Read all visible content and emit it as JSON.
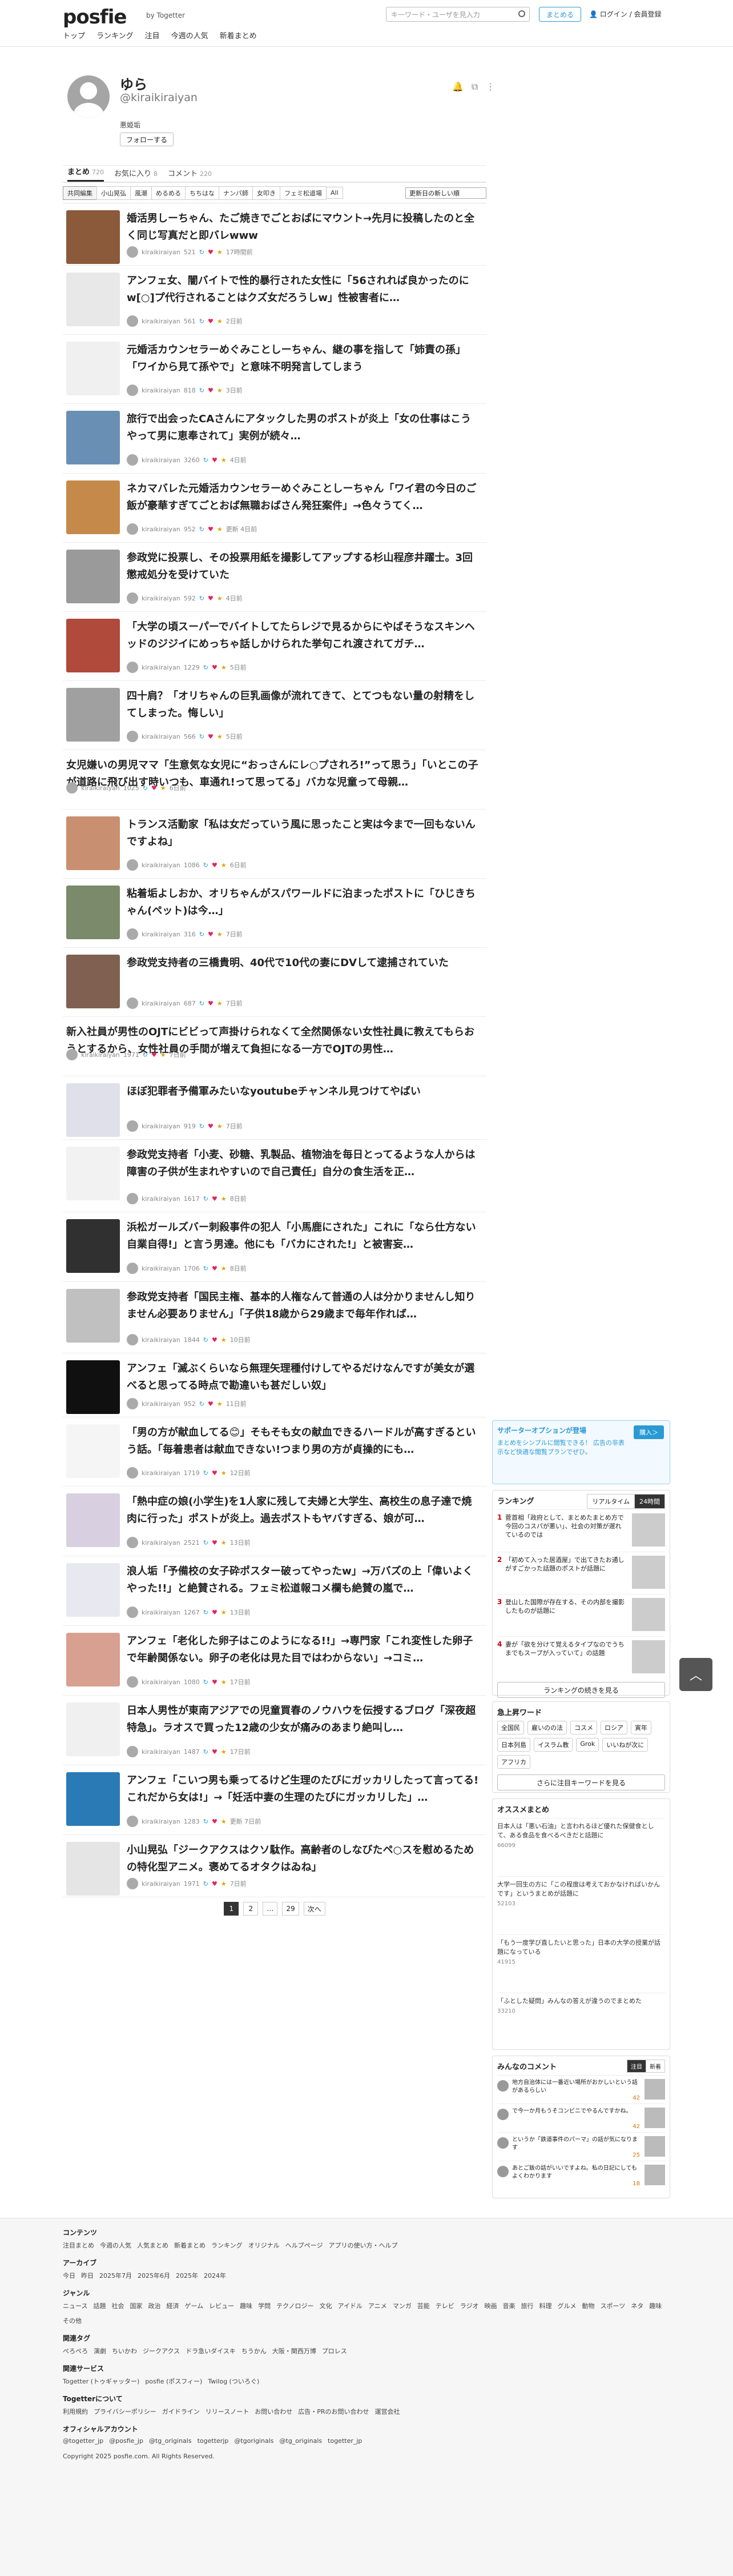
{
  "header": {
    "logo": "posfie",
    "togetter": "Togetter",
    "nav": [
      "トップ",
      "ランキング",
      "注目",
      "今週の人気",
      "新着まとめ"
    ],
    "search_placeholder": "キーワード・ユーザを見入力",
    "summarize_button": "まとめる",
    "login": "ログイン / 会員登録"
  },
  "profile": {
    "name": "ゆら",
    "handle": "@kiraikiraiyan",
    "bio": "悪姫垢",
    "follow": "フォローする"
  },
  "tabs": [
    {
      "label": "まとめ",
      "count": "720"
    },
    {
      "label": "お気に入り",
      "count": "8"
    },
    {
      "label": "コメント",
      "count": "220"
    }
  ],
  "filters": [
    "共同編集",
    "小山晃弘",
    "風潮",
    "めるめる",
    "ちちはな",
    "ナンパ師",
    "女叩き",
    "フェミ松道場",
    "All"
  ],
  "sort_select": "更新日の新しい順",
  "items": [
    {
      "title": "婚活男しーちゃん、たご焼きでごとおばにマウント→先月に投稿したのと全く同じ写真だと即バレwww",
      "user": "kiraikiraiyan",
      "stats": "521",
      "time": "17時間前",
      "thumb": "#8a5a3a",
      "nothumb": false
    },
    {
      "title": "アンフェ女、闇バイトで性的暴行された女性に「56されれば良かったのにw[○]プ代行されることはクズ女だろうしw」性被害者に…",
      "user": "kiraikiraiyan",
      "stats": "561",
      "time": "2日前",
      "thumb": "#e8e8e8",
      "nothumb": false
    },
    {
      "title": "元婚活カウンセラーめぐみことしーちゃん、継の事を指して「姉責の孫」「ワイから見て孫やで」と意味不明発言してしまう",
      "user": "kiraikiraiyan",
      "stats": "818",
      "time": "3日前",
      "thumb": "#f0f0f0",
      "nothumb": false
    },
    {
      "title": "旅行で出会ったCAさんにアタックした男のポストが炎上「女の仕事はこうやって男に恵奉されて」実例が続々…",
      "user": "kiraikiraiyan",
      "stats": "3260",
      "time": "4日前",
      "thumb": "#6a8fb5",
      "nothumb": false
    },
    {
      "title": "ネカマバレた元婚活カウンセラーめぐみことしーちゃん「ワイ君の今日のご飯が豪華すぎてごとおば無職おばさん発狂案件」→色々うてく…",
      "user": "kiraikiraiyan",
      "stats": "952",
      "time": "更新 4日前",
      "thumb": "#c58a4a",
      "nothumb": false
    },
    {
      "title": "参政党に投票し、その投票用紙を撮影してアップする杉山程彦井躍士。3回懲戒処分を受けていた",
      "user": "kiraikiraiyan",
      "stats": "592",
      "time": "4日前",
      "thumb": "#9a9a9a",
      "nothumb": false
    },
    {
      "title": "「大学の頃スーパーでバイトしてたらレジで見るからにやばそうなスキンヘッドのジジイにめっちゃ話しかけられた挙句これ渡されてガチ…",
      "user": "kiraikiraiyan",
      "stats": "1229",
      "time": "5日前",
      "thumb": "#b04a3a",
      "nothumb": false
    },
    {
      "title": "四十肩？「オリちゃんの巨乳画像が流れてきて、とてつもない量の射精をしてしまった。悔しい」",
      "user": "kiraikiraiyan",
      "stats": "566",
      "time": "5日前",
      "thumb": "#a0a0a0",
      "nothumb": false
    },
    {
      "title": "女児嫌いの男児ママ「生意気な女児に“おっさんにレ○プされろ!”って思う」「いとこの子が道路に飛び出す時いつも、車通れ!って思ってる」バカな児童って母親…",
      "user": "kiraikiraiyan",
      "stats": "1025",
      "time": "6日前",
      "thumb": "",
      "nothumb": true
    },
    {
      "title": "トランス活動家「私は女だっていう風に思ったこと実は今まで一回もないんですよね」",
      "user": "kiraikiraiyan",
      "stats": "1086",
      "time": "6日前",
      "thumb": "#c89070",
      "nothumb": false
    },
    {
      "title": "粘着垢よしおか、オリちゃんがスパワールドに泊まったポストに「ひじきちゃん(ペット)は今…」",
      "user": "kiraikiraiyan",
      "stats": "316",
      "time": "7日前",
      "thumb": "#7a8a6a",
      "nothumb": false
    },
    {
      "title": "参政党支持者の三橋貴明、40代で10代の妻にDVして逮捕されていた",
      "user": "kiraikiraiyan",
      "stats": "687",
      "time": "7日前",
      "thumb": "#806050",
      "nothumb": false
    },
    {
      "title": "新入社員が男性のOJTにビビって声掛けられなくて全然関係ない女性社員に教えてもらおうとするから、女性社員の手間が増えて負担になる一方でOJTの男性…",
      "user": "kiraikiraiyan",
      "stats": "1971",
      "time": "7日前",
      "thumb": "",
      "nothumb": true
    },
    {
      "title": "ほぼ犯罪者予備軍みたいなyoutubeチャンネル見つけてやばい",
      "user": "kiraikiraiyan",
      "stats": "919",
      "time": "7日前",
      "thumb": "#e0e0ea",
      "nothumb": false
    },
    {
      "title": "参政党支持者「小麦、砂糖、乳製品、植物油を毎日とってるような人からは障害の子供が生まれやすいので自己責任」自分の食生活を正…",
      "user": "kiraikiraiyan",
      "stats": "1617",
      "time": "8日前",
      "thumb": "#f2f2f2",
      "nothumb": false
    },
    {
      "title": "浜松ガールズバー刺殺事件の犯人「小馬鹿にされた」これに「なら仕方ない自業自得!」と言う男達。他にも「バカにされた!」と被害妄…",
      "user": "kiraikiraiyan",
      "stats": "1706",
      "time": "8日前",
      "thumb": "#303030",
      "nothumb": false
    },
    {
      "title": "参政党支持者「国民主権、基本的人権なんて普通の人は分かりませんし知りません必要ありません」「子供18歳から29歳まで毎年作れば…",
      "user": "kiraikiraiyan",
      "stats": "1844",
      "time": "10日前",
      "thumb": "#c0c0c0",
      "nothumb": false
    },
    {
      "title": "アンフェ「滅ぶくらいなら無理矢理種付けしてやるだけなんですが美女が選べると思ってる時点で勘違いも甚だしい奴」",
      "user": "kiraikiraiyan",
      "stats": "952",
      "time": "11日前",
      "thumb": "#101010",
      "nothumb": false
    },
    {
      "title": "「男の方が献血してる😊」そもそも女の献血できるハードルが高すぎるという話。「毎着患者は献血できない!つまり男の方が貞操的にも…",
      "user": "kiraikiraiyan",
      "stats": "1719",
      "time": "12日前",
      "thumb": "#f5f5f5",
      "nothumb": false
    },
    {
      "title": "「熱中症の娘(小学生)を1人家に残して夫婦と大学生、高校生の息子達で焼肉に行った」ポストが炎上。過去ポストもヤバすぎる、娘が可…",
      "user": "kiraikiraiyan",
      "stats": "2521",
      "time": "13日前",
      "thumb": "#d8d0e0",
      "nothumb": false
    },
    {
      "title": "浪人垢「予備校の女子砕ポスター破ってやったw」→万バズの上「偉いよくやった!!」と絶賛される。フェミ松道報コメ欄も絶賛の嵐で…",
      "user": "kiraikiraiyan",
      "stats": "1267",
      "time": "13日前",
      "thumb": "#e8e8f0",
      "nothumb": false
    },
    {
      "title": "アンフェ「老化した卵子はこのようになる!!」→専門家「これ変性した卵子で年齢関係ない。卵子の老化は見た目ではわからない」→コミ…",
      "user": "kiraikiraiyan",
      "stats": "1080",
      "time": "17日前",
      "thumb": "#d8a090",
      "nothumb": false
    },
    {
      "title": "日本人男性が東南アジアでの児童買春のノウハウを伝授するブログ「深夜超特急」。ラオスで買った12歳の少女が痛みのあまり絶叫し…",
      "user": "kiraikiraiyan",
      "stats": "1487",
      "time": "17日前",
      "thumb": "#f0f0f0",
      "nothumb": false
    },
    {
      "title": "アンフェ「こいつ男も乗ってるけど生理のたびにガッカリしたって言ってる!これだから女は!」→「妊活中妻の生理のたびにガッカリした」…",
      "user": "kiraikiraiyan",
      "stats": "1283",
      "time": "更新 7日前",
      "thumb": "#2a7ab5",
      "nothumb": false
    },
    {
      "title": "小山晃弘「ジークアクスはクソ駄作。高齢者のしなびたペ○スを慰めるための特化型アニメ。褒めてるオタクはゐね」",
      "user": "kiraikiraiyan",
      "stats": "1971",
      "time": "7日前",
      "thumb": "#e5e5e5",
      "nothumb": false
    }
  ],
  "pagination": {
    "pages": [
      "1",
      "2",
      "…",
      "29"
    ],
    "next": "次へ"
  },
  "sidebar": {
    "support": {
      "title": "サポーターオプションが登場",
      "text": "まとめをシンプルに閲覧できる！ 広告の非表示など快適な閲覧プランでぜひ。",
      "button": "購入＞"
    },
    "ranking": {
      "title": "ランキング",
      "tabs": [
        "リアルタイム",
        "24時間"
      ],
      "items": [
        {
          "rank": "1",
          "text": "菅首相「政府として、まとめたまとめ方で今回のコスパが悪い」、社会の対策が遅れているのでは"
        },
        {
          "rank": "2",
          "text": "「初めて入った居酒屋」で出てきたお通しがすごかった話題のポストが話題に"
        },
        {
          "rank": "3",
          "text": "登山した国際が存在する、その内部を撮影したものが話題に"
        },
        {
          "rank": "4",
          "text": "妻が「欲を分けて覚えるタイプなのでうちまでもスープが入っていて」の話題"
        }
      ],
      "more": "ランキングの続きを見る"
    },
    "keywords": {
      "title": "急上昇ワード",
      "items": [
        "全国民",
        "雇いのの法",
        "コスメ",
        "ロシア",
        "寅年",
        "日本列島",
        "イスラム教",
        "Grok",
        "いいねが次に",
        "アフリカ"
      ],
      "more": "さらに注目キーワードを見る"
    },
    "recommend": {
      "title": "オススメまとめ",
      "items": [
        {
          "text": "日本人は「悪い石油」と言われるほど優れた保健食として、ある食品を食べるべきだと話題に",
          "stats": "66099"
        },
        {
          "text": "大学一回生の方に「この程度は考えておかなければいかんです」というまとめが話題に",
          "stats": "52103"
        },
        {
          "text": "「もう一度学び直したいと思った」日本の大学の授業が話題になっている",
          "stats": "41915"
        },
        {
          "text": "「ふとした疑問」みんなの答えが違うのでまとめた",
          "stats": "33210"
        }
      ]
    },
    "comments": {
      "title": "みんなのコメント",
      "tabs": [
        "注目",
        "新着"
      ],
      "items": [
        {
          "text": "地方自治体には一番近い場所がおかしいという話があるらしい",
          "likes": "42"
        },
        {
          "text": "で今一か月もうそコンビニでやるんですかね。",
          "likes": "42"
        },
        {
          "text": "というか「鉄道事件のパーマ」の話が気になります",
          "likes": "25"
        },
        {
          "text": "あとご飯の話がいいですよね。私の日記にしてもよくわかります",
          "likes": "18"
        }
      ]
    }
  },
  "footer": {
    "sections": [
      {
        "title": "コンテンツ",
        "links": [
          "注目まとめ",
          "今週の人気",
          "人気まとめ",
          "新着まとめ",
          "ランキング",
          "オリジナル",
          "ヘルプページ",
          "アプリの使い方・ヘルプ"
        ]
      },
      {
        "title": "アーカイブ",
        "links": [
          "今日",
          "昨日",
          "2025年7月",
          "2025年6月",
          "2025年",
          "2024年"
        ]
      },
      {
        "title": "ジャンル",
        "links": [
          "ニュース",
          "話題",
          "社会",
          "国家",
          "政治",
          "経済",
          "ゲーム",
          "レビュー",
          "趣味",
          "学問",
          "テクノロジー",
          "文化",
          "アイドル",
          "アニメ",
          "マンガ",
          "芸能",
          "テレビ",
          "ラジオ",
          "映画",
          "音楽",
          "旅行",
          "料理",
          "グルメ",
          "動物",
          "スポーツ",
          "ネタ",
          "趣味",
          "その他"
        ]
      },
      {
        "title": "関連タグ",
        "links": [
          "ぺろぺろ",
          "演劇",
          "ちいかわ",
          "ジークアクス",
          "ドラ急いダイスキ",
          "ちうかん",
          "大阪・関西万博",
          "プロレス"
        ]
      },
      {
        "title": "関連サービス",
        "links": [
          "Togetter (トゥギャッター)",
          "posfie (ポスフィー)",
          "Twilog (ついろぐ)"
        ]
      },
      {
        "title": "Togetterについて",
        "links": [
          "利用規約",
          "プライバシーポリシー",
          "ガイドライン",
          "リリースノート",
          "お問い合わせ",
          "広告・PRのお問い合わせ",
          "運営会社"
        ]
      },
      {
        "title": "オフィシャルアカウント",
        "links": [
          "@togetter_jp",
          "@posfie_jp",
          "@tg_originals",
          "togetterjp",
          "@tgoriginals",
          "@tg_originals",
          "togetter_jp"
        ]
      }
    ],
    "copyright": "Copyright 2025 posfie.com. All Rights Reserved."
  }
}
